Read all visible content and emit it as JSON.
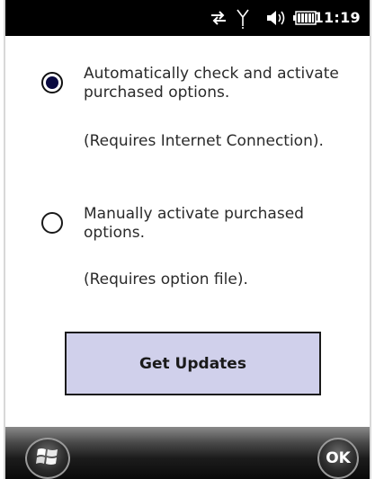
{
  "status_bar": {
    "time": "11:19",
    "icons": [
      "connectivity-arrows-icon",
      "signal-antenna-icon",
      "speaker-volume-icon",
      "battery-icon"
    ]
  },
  "options": [
    {
      "label": "Automatically check and activate purchased options.",
      "note": "(Requires Internet Connection).",
      "selected": true
    },
    {
      "label": "Manually activate purchased options.",
      "note": "(Requires option file).",
      "selected": false
    }
  ],
  "get_updates_label": "Get Updates",
  "softkeys": {
    "start_icon": "windows-start-icon",
    "ok_label": "OK"
  },
  "colors": {
    "button_fill": "#d0d0eb",
    "radio_dot": "#0a0a40",
    "status_bar": "#000000"
  }
}
